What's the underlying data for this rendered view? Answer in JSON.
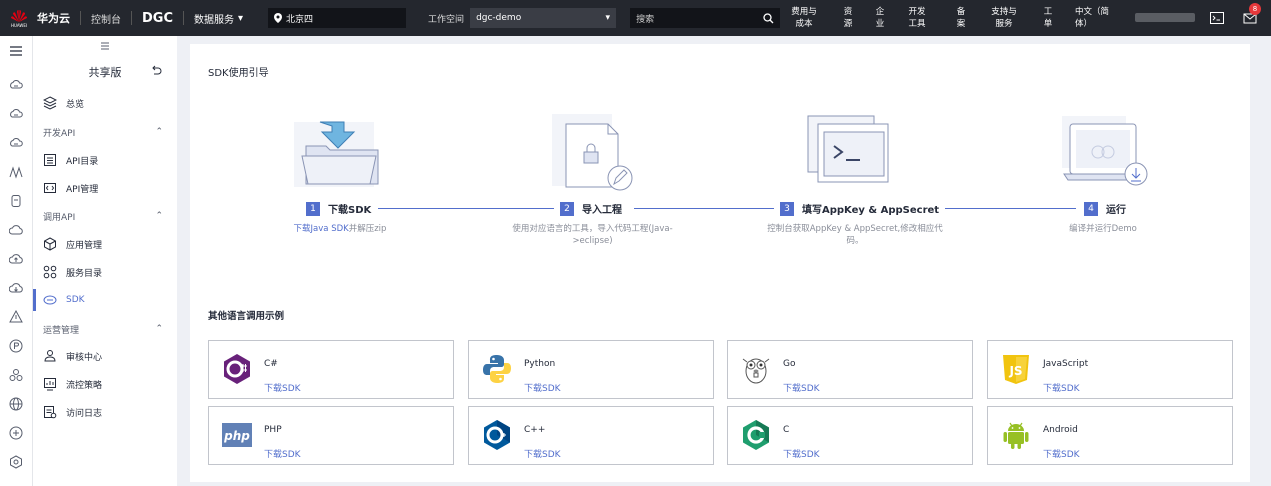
{
  "topbar": {
    "logo_text": "HUAWEI",
    "brand": "华为云",
    "console": "控制台",
    "product": "DGC",
    "service_menu": "数据服务",
    "region": "北京四",
    "workspace_label": "工作空间",
    "workspace_value": "dgc-demo",
    "search_placeholder": "搜索",
    "nav": [
      "费用与\n成本",
      "资\n源",
      "企\n业",
      "开发\n工具",
      "备\n案",
      "支持与\n服务",
      "工\n单",
      "中文（简\n体）"
    ],
    "notification_count": "8"
  },
  "sidebar": {
    "title": "共享版",
    "overview": "总览",
    "group_dev": "开发API",
    "api_catalog": "API目录",
    "api_manage": "API管理",
    "group_call": "调用API",
    "app_manage": "应用管理",
    "service_catalog": "服务目录",
    "sdk": "SDK",
    "group_ops": "运营管理",
    "review_center": "审核中心",
    "flow_policy": "流控策略",
    "access_log": "访问日志"
  },
  "main": {
    "guide_title": "SDK使用引导",
    "steps": [
      {
        "num": "1",
        "title": "下载SDK",
        "desc_link": "下载Java SDK",
        "desc_rest": "并解压zip"
      },
      {
        "num": "2",
        "title": "导入工程",
        "desc_line1": "使用对应语言的工具，导入代码工程(Java-",
        "desc_line2": ">eclipse)"
      },
      {
        "num": "3",
        "title": "填写AppKey & AppSecret",
        "desc_line1": "控制台获取AppKey & AppSecret,修改相应代",
        "desc_line2": "码。"
      },
      {
        "num": "4",
        "title": "运行",
        "desc_line1": "编译并运行Demo"
      }
    ],
    "examples_title": "其他语言调用示例",
    "download_label": "下载SDK",
    "languages": [
      "C#",
      "Python",
      "Go",
      "JavaScript",
      "PHP",
      "C++",
      "C",
      "Android"
    ],
    "colors": {
      "accent": "#526ecc",
      "topbar": "#24272e",
      "badge": "#e5383b"
    }
  }
}
